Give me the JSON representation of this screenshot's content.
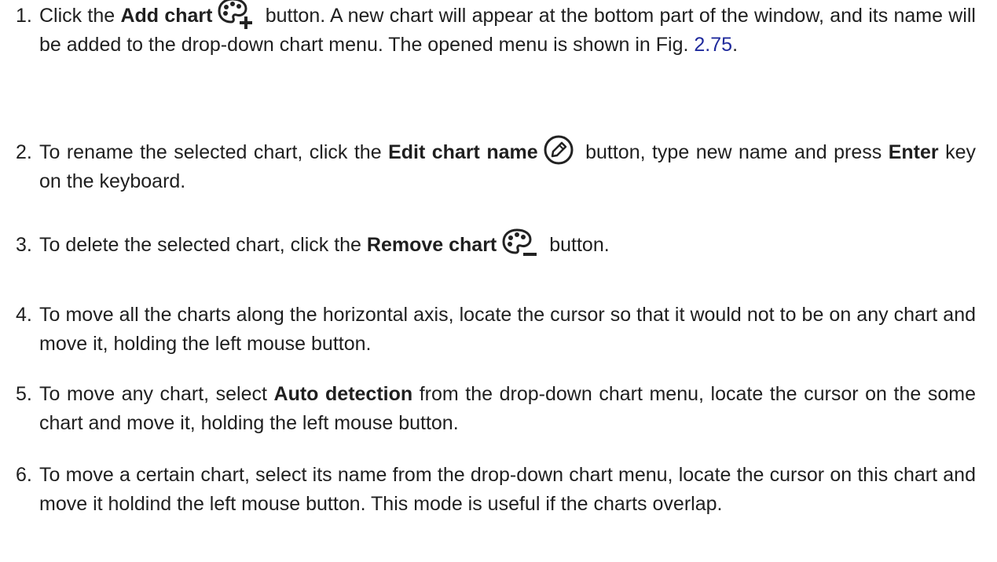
{
  "steps": [
    {
      "number": "1.",
      "lead": "Click the ",
      "bold": "Add chart",
      "icon": "palette-plus-icon",
      "rest": " button.  A new chart will appear at the bottom part of the window, and its name will be added to the drop-down chart menu.  The opened menu is shown in Fig. ",
      "link": "2.75",
      "tail": "."
    },
    {
      "number": "2.",
      "lead": "To rename the selected chart, click the ",
      "bold": "Edit chart name",
      "icon": "pencil-circle-icon",
      "rest": " button, type new name and press ",
      "bold2": "Enter",
      "tail": " key on the keyboard."
    },
    {
      "number": "3.",
      "lead": "To delete the selected chart, click the ",
      "bold": "Remove chart",
      "icon": "palette-minus-icon",
      "tail": " button."
    },
    {
      "number": "4.",
      "text": "To move all the charts along the horizontal axis, locate the cursor so that it would not to be on any chart and move it, holding the left mouse button."
    },
    {
      "number": "5.",
      "lead": "To move any chart, select ",
      "bold": "Auto detection",
      "tail": " from the drop-down chart menu, locate the cursor on the some chart and move it, holding the left mouse button."
    },
    {
      "number": "6.",
      "text": "To move a certain chart, select its name from the drop-down chart menu, locate the cursor on this chart and move it holdind the left mouse button. This mode is useful if the charts overlap."
    }
  ]
}
